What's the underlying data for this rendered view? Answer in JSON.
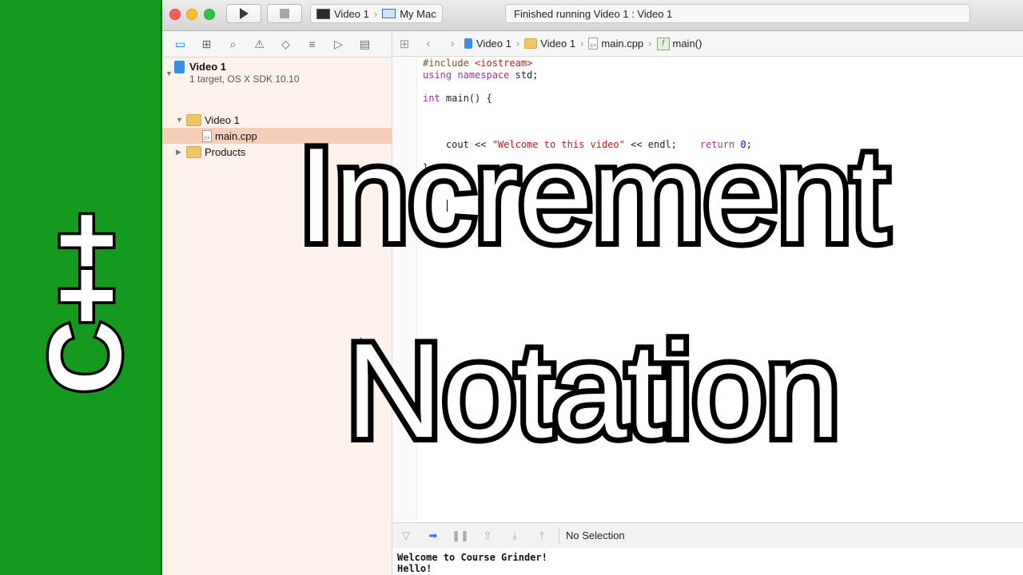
{
  "overlay": {
    "logo_text": "C++",
    "title_line1": "Increment",
    "title_line2": "Notation",
    "accent_color": "#149a1f"
  },
  "toolbar": {
    "scheme_target": "Video 1",
    "scheme_device": "My Mac",
    "status_text": "Finished running Video 1 : Video 1"
  },
  "navigator": {
    "tab_icons": [
      "folder-icon",
      "hierarchy-icon",
      "search-icon",
      "warning-icon",
      "test-icon",
      "debug-icon",
      "breakpoint-icon",
      "log-icon"
    ],
    "project_name": "Video 1",
    "project_subtitle": "1 target, OS X SDK 10.10",
    "group_name": "Video 1",
    "file_name": "main.cpp",
    "file_badge": "c+",
    "products_name": "Products"
  },
  "jumpbar": {
    "crumbs": [
      "Video 1",
      "Video 1",
      "main.cpp",
      "main()"
    ],
    "function_badge": "f"
  },
  "code": {
    "line1_directive": "#include ",
    "line1_header": "<iostream>",
    "line2_kw": "using namespace",
    "line2_rest": " std;",
    "line4_kw": "int",
    "line4_rest": " main() {",
    "line8_prefix": "    cout << ",
    "line8_string": "\"Welcome to this video\"",
    "line8_suffix": " << endl;",
    "line20_kw": "    return",
    "line20_num": "0",
    "line20_end": ";",
    "line22_brace": "}"
  },
  "debugbar": {
    "selection_text": "No Selection"
  },
  "console": {
    "line1": "Welcome to Course Grinder!",
    "line2": "Hello!"
  }
}
